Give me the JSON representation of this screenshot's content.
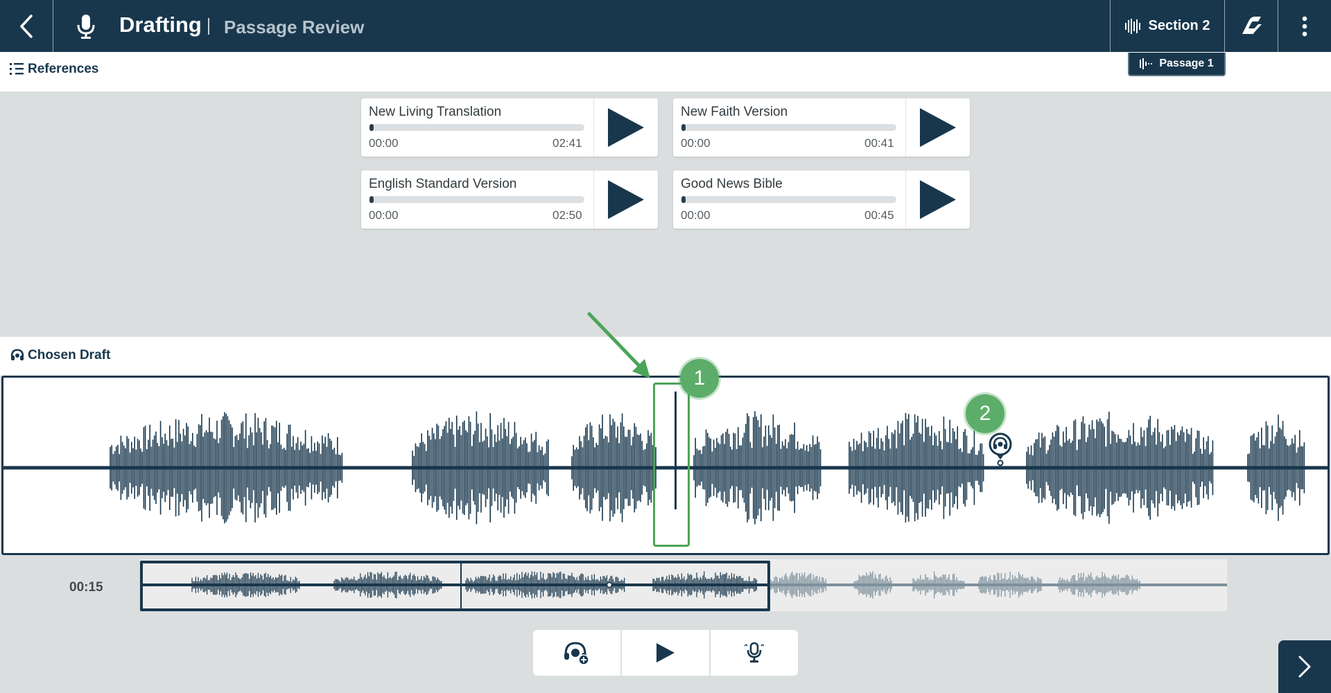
{
  "header": {
    "title": "Drafting",
    "subtitle": "Passage Review",
    "section_label": "Section 2",
    "passage_label": "Passage 1"
  },
  "references": {
    "heading": "References",
    "items": [
      {
        "name": "New Living Translation",
        "start": "00:00",
        "end": "02:41",
        "progress": 0
      },
      {
        "name": "New Faith Version",
        "start": "00:00",
        "end": "00:41",
        "progress": 0
      },
      {
        "name": "English Standard Version",
        "start": "00:00",
        "end": "02:50",
        "progress": 0
      },
      {
        "name": "Good News Bible",
        "start": "00:00",
        "end": "00:45",
        "progress": 0
      }
    ]
  },
  "draft": {
    "heading": "Chosen Draft",
    "current_time": "00:15"
  },
  "annotations": {
    "badge_1": "1",
    "badge_2": "2"
  },
  "colors": {
    "primary": "#18374d",
    "annotation_green": "#4ca458",
    "background": "#dbdedf"
  },
  "icons": [
    "back-icon",
    "microphone-icon",
    "waveform-icon",
    "logo-icon",
    "more-vertical-icon",
    "list-icon",
    "headset-icon",
    "play-icon",
    "add-comment-icon",
    "record-icon",
    "chevron-right-icon"
  ]
}
